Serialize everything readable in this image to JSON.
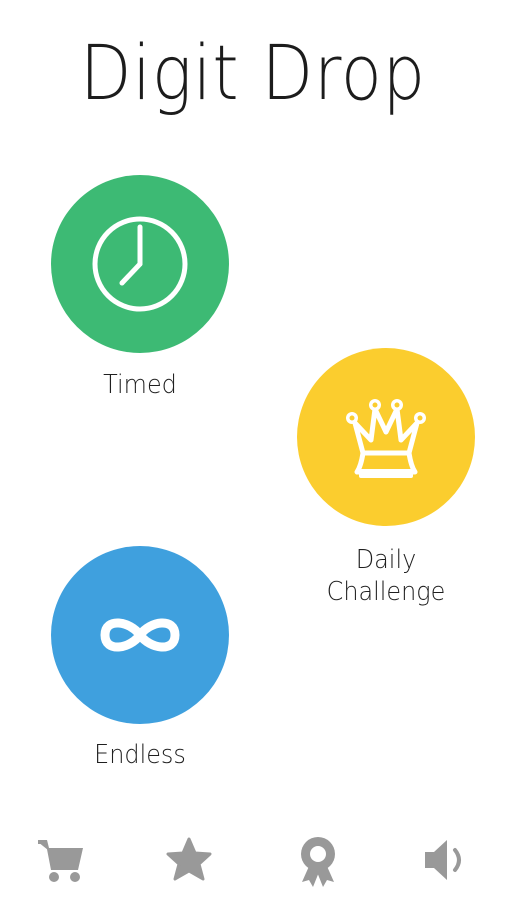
{
  "app": {
    "title": "Digit Drop"
  },
  "modes": {
    "timed": {
      "label": "Timed",
      "icon": "clock-icon",
      "color": "#3dba74"
    },
    "daily": {
      "label_line1": "Daily",
      "label_line2": "Challenge",
      "icon": "crown-icon",
      "color": "#fbcd2e"
    },
    "endless": {
      "label": "Endless",
      "icon": "infinity-icon",
      "color": "#3fa0de"
    }
  },
  "bottom_bar": {
    "icon_color": "#999999",
    "items": [
      {
        "icon": "cart-icon"
      },
      {
        "icon": "star-icon"
      },
      {
        "icon": "award-ribbon-icon"
      },
      {
        "icon": "speaker-icon"
      }
    ]
  }
}
